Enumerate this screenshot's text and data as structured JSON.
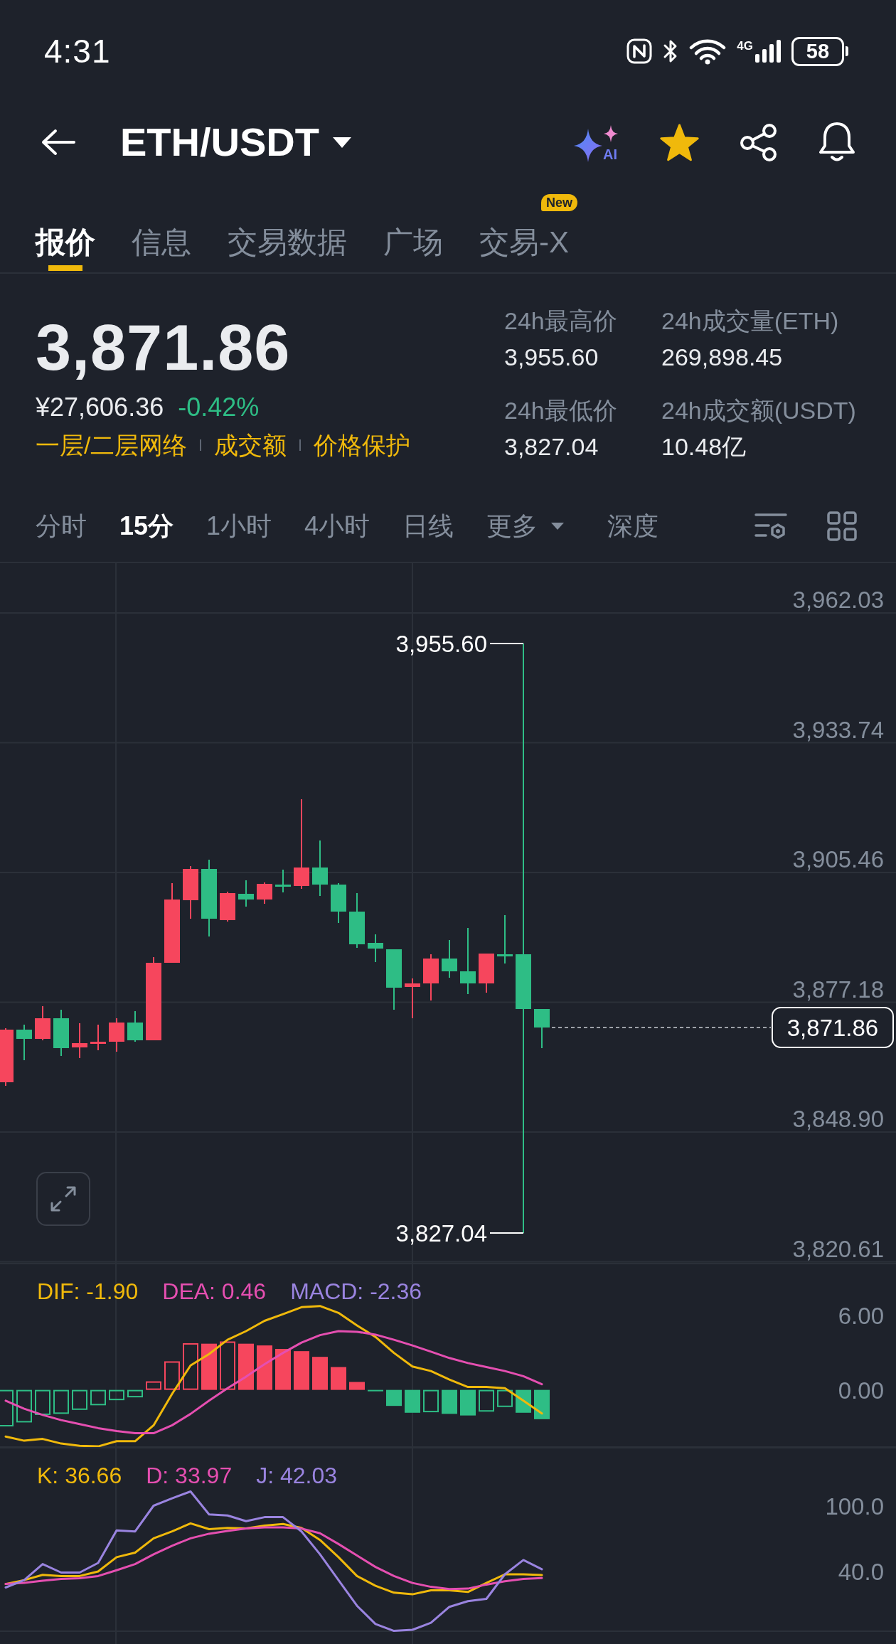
{
  "status_bar": {
    "time": "4:31",
    "network": "4G",
    "battery": "58"
  },
  "header": {
    "title": "ETH/USDT",
    "ai_label": "AI",
    "favorited": true
  },
  "tabs": [
    {
      "label": "报价",
      "selected": true
    },
    {
      "label": "信息",
      "selected": false
    },
    {
      "label": "交易数据",
      "selected": false
    },
    {
      "label": "广场",
      "selected": false
    },
    {
      "label": "交易-X",
      "selected": false,
      "badge": "New"
    }
  ],
  "ticker": {
    "last_price": "3,871.86",
    "fiat_price": "¥27,606.36",
    "change": "-0.42%",
    "falling": true,
    "links": [
      "一层/二层网络",
      "成交额",
      "价格保护"
    ],
    "stats": [
      {
        "label": "24h最高价",
        "value": "3,955.60"
      },
      {
        "label": "24h成交量(ETH)",
        "value": "269,898.45"
      },
      {
        "label": "24h最低价",
        "value": "3,827.04"
      },
      {
        "label": "24h成交额(USDT)",
        "value": "10.48亿"
      }
    ]
  },
  "intervals": [
    {
      "label": "分时",
      "kind": "option",
      "selected": false
    },
    {
      "label": "15分",
      "kind": "option",
      "selected": true
    },
    {
      "label": "1小时",
      "kind": "option",
      "selected": false
    },
    {
      "label": "4小时",
      "kind": "option",
      "selected": false
    },
    {
      "label": "日线",
      "kind": "option",
      "selected": false
    },
    {
      "label": "更多",
      "kind": "dropdown",
      "selected": false
    },
    {
      "label": "深度",
      "kind": "option",
      "selected": false
    }
  ],
  "chart": {
    "price_axis": [
      "3,962.03",
      "3,933.74",
      "3,905.46",
      "3,877.18",
      "3,848.90",
      "3,820.61"
    ],
    "high_marker": "3,955.60",
    "low_marker": "3,827.04",
    "last_price_tag": "3,871.86"
  },
  "macd": {
    "chart_data": {
      "type": "line",
      "ylim": [
        -4.6,
        10.17
      ],
      "yticks": [
        {
          "value": 6,
          "label": "6.00"
        },
        {
          "value": 0,
          "label": "0.00"
        }
      ],
      "series": [
        {
          "name": "DIF: -1.90",
          "color": "#f0b90b",
          "values": [
            -3.76,
            -4.09,
            -3.95,
            -4.32,
            -4.5,
            -4.55,
            -4.13,
            -4.13,
            -2.85,
            -0.32,
            1.97,
            2.89,
            4.04,
            4.73,
            5.56,
            6.1,
            6.66,
            6.75,
            6.2,
            5.19,
            4.27,
            2.98,
            1.88,
            1.52,
            0.83,
            0.23,
            0.23,
            0.14,
            -0.87,
            -1.9
          ]
        },
        {
          "name": "DEA: 0.46",
          "color": "#e54fb1",
          "values": [
            -0.87,
            -1.52,
            -2.02,
            -2.43,
            -2.75,
            -3.08,
            -3.31,
            -3.49,
            -3.49,
            -2.85,
            -1.93,
            -0.87,
            0.14,
            1.06,
            2.07,
            2.98,
            3.81,
            4.41,
            4.73,
            4.68,
            4.45,
            4.04,
            3.58,
            3.08,
            2.57,
            2.16,
            1.84,
            1.52,
            1.1,
            0.46
          ]
        },
        {
          "type": "bar",
          "color": "#f6465d",
          "values": [
            null,
            null,
            null,
            null,
            null,
            null,
            null,
            null,
            0.69,
            2.3,
            3.76,
            3.72,
            3.9,
            3.72,
            3.58,
            3.3,
            3.12,
            2.66,
            1.84,
            0.64,
            null,
            null,
            null,
            null,
            null,
            null,
            null,
            null,
            null,
            null
          ]
        },
        {
          "type": "bar",
          "color": "#2ebd85",
          "values": [
            -2.94,
            -2.62,
            -2.02,
            -1.93,
            -1.61,
            -1.24,
            -0.83,
            -0.6,
            null,
            null,
            null,
            null,
            null,
            null,
            null,
            null,
            null,
            null,
            null,
            null,
            -0.1,
            -1.29,
            -1.84,
            -1.8,
            -1.93,
            -2.06,
            -1.75,
            -1.38,
            -1.84,
            -2.36
          ]
        }
      ]
    },
    "histogram_label": "MACD: -2.36"
  },
  "kdj": {
    "chart_data": {
      "type": "line",
      "ylim": [
        -14.78,
        153.48
      ],
      "yticks": [
        {
          "value": 100,
          "label": "100.0"
        },
        {
          "value": 40,
          "label": "40.0"
        }
      ],
      "series": [
        {
          "name": "K: 36.66",
          "color": "#f0b90b",
          "values": [
            28.5,
            32.1,
            36.9,
            35.8,
            35.8,
            40.0,
            53.1,
            57.3,
            70.4,
            76.7,
            84.1,
            78.8,
            79.9,
            79.4,
            82.0,
            83.5,
            79.9,
            68.9,
            53.1,
            35.8,
            26.9,
            20.6,
            19.1,
            22.7,
            22.7,
            21.2,
            29.5,
            37.4,
            37.4,
            36.7
          ]
        },
        {
          "name": "D: 33.97",
          "color": "#e54fb1",
          "values": [
            28.5,
            29.5,
            31.6,
            33.2,
            33.8,
            35.8,
            41.1,
            46.8,
            55.7,
            63.6,
            70.4,
            74.6,
            77.2,
            79.4,
            80.4,
            80.4,
            79.4,
            75.1,
            65.2,
            54.7,
            44.2,
            35.8,
            29.5,
            25.9,
            23.8,
            24.3,
            28.0,
            31.1,
            33.2,
            34.0
          ]
        },
        {
          "name": "J: 42.03",
          "color": "#9a84e0",
          "values": [
            25.3,
            32.1,
            46.8,
            39.0,
            39.0,
            47.8,
            77.7,
            76.7,
            100.3,
            107.1,
            113.4,
            92.4,
            91.4,
            86.1,
            89.8,
            89.8,
            76.7,
            55.7,
            32.1,
            8.6,
            -8.2,
            -14.5,
            -13.5,
            -7.1,
            7.6,
            12.8,
            14.9,
            37.4,
            50.5,
            42.0
          ]
        }
      ]
    }
  }
}
